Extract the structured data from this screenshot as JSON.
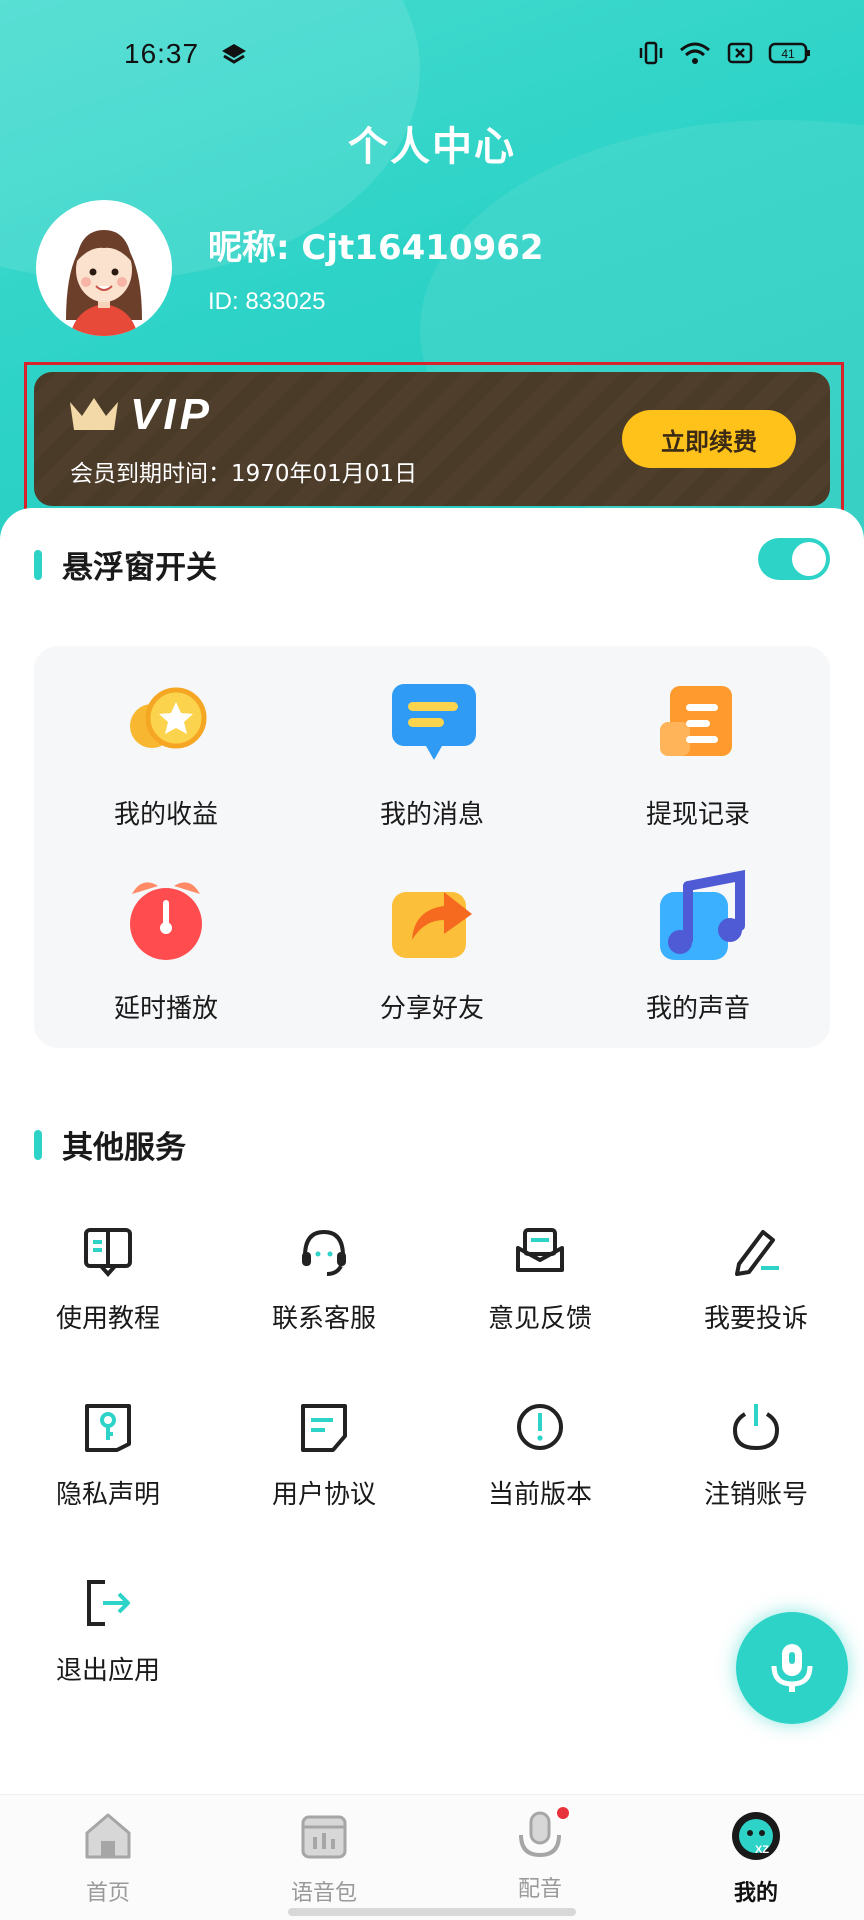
{
  "status_bar": {
    "time": "16:37",
    "battery": "41"
  },
  "header": {
    "title": "个人中心",
    "nickname": "昵称: Cjt16410962",
    "user_id": "ID: 833025"
  },
  "vip": {
    "badge": "VIP",
    "expire_text": "会员到期时间：1970年01月01日",
    "renew_label": "立即续费"
  },
  "float_window": {
    "label": "悬浮窗开关",
    "enabled": true
  },
  "features": [
    {
      "label": "我的收益",
      "icon": "coin-icon"
    },
    {
      "label": "我的消息",
      "icon": "message-icon"
    },
    {
      "label": "提现记录",
      "icon": "record-icon"
    },
    {
      "label": "延时播放",
      "icon": "alarm-clock-icon"
    },
    {
      "label": "分享好友",
      "icon": "share-icon"
    },
    {
      "label": "我的声音",
      "icon": "music-icon"
    }
  ],
  "other_services": {
    "title": "其他服务",
    "items": [
      {
        "label": "使用教程",
        "icon": "book-icon"
      },
      {
        "label": "联系客服",
        "icon": "headset-icon"
      },
      {
        "label": "意见反馈",
        "icon": "mail-icon"
      },
      {
        "label": "我要投诉",
        "icon": "pen-icon"
      },
      {
        "label": "隐私声明",
        "icon": "key-icon"
      },
      {
        "label": "用户协议",
        "icon": "document-icon"
      },
      {
        "label": "当前版本",
        "icon": "info-icon"
      },
      {
        "label": "注销账号",
        "icon": "power-icon"
      },
      {
        "label": "退出应用",
        "icon": "logout-icon"
      }
    ]
  },
  "bottom_nav": [
    {
      "label": "首页",
      "icon": "home-icon",
      "active": false
    },
    {
      "label": "语音包",
      "icon": "voice-pack-icon",
      "active": false
    },
    {
      "label": "配音",
      "icon": "mic-icon",
      "active": false,
      "badge_dot": true
    },
    {
      "label": "我的",
      "icon": "profile-icon",
      "active": true
    }
  ],
  "colors": {
    "accent": "#2ed3c7",
    "vip_bg": "#4a3a28",
    "renew_btn": "#ffc21a",
    "highlight_outline": "#d9232a"
  }
}
